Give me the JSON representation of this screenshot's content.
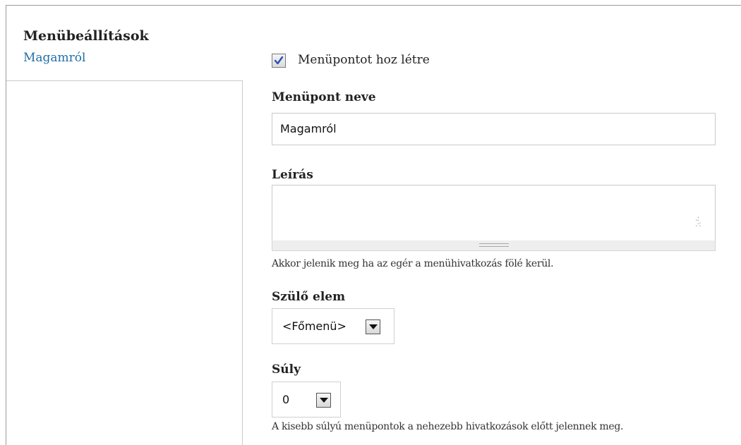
{
  "vertical_tab": {
    "title": "Menübeállítások",
    "summary": "Magamról"
  },
  "menu_settings": {
    "create_menu_item": {
      "label": "Menüpontot hoz létre",
      "checked": true
    },
    "title_field": {
      "label": "Menüpont neve",
      "value": "Magamról"
    },
    "description_field": {
      "label": "Leírás",
      "value": "",
      "help": "Akkor jelenik meg ha az egér a menühivatkozás fölé kerül."
    },
    "parent_field": {
      "label": "Szülő elem",
      "selected": "<Főmenü>"
    },
    "weight_field": {
      "label": "Súly",
      "selected": "0",
      "help": "A kisebb súlyú menüpontok a nehezebb hivatkozások előtt jelennek meg."
    }
  },
  "colors": {
    "link": "#1f6fa8",
    "checkbox_check": "#2a4fb3",
    "border": "#c9c9c9"
  }
}
